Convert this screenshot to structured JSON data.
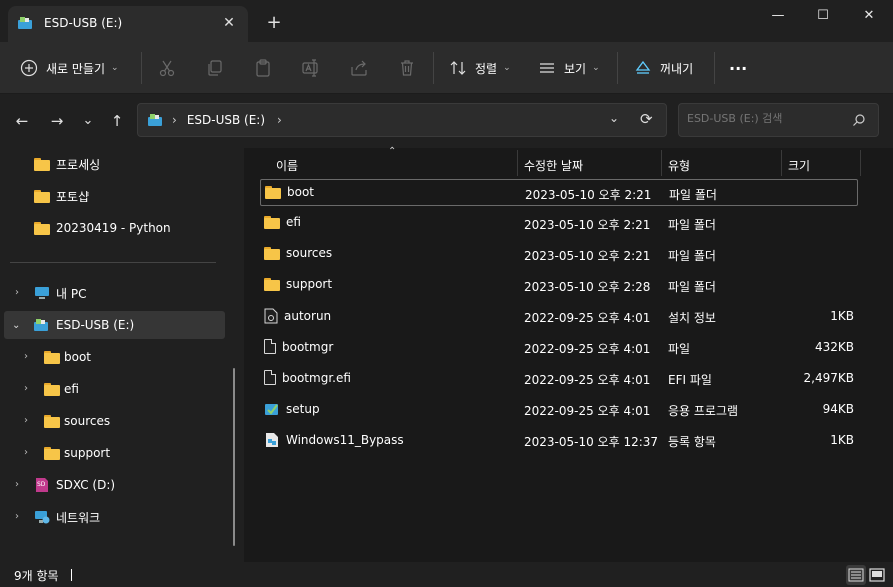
{
  "window": {
    "tab_title": "ESD-USB (E:)",
    "tab_close": "✕",
    "new_tab": "+",
    "minimize": "—",
    "maximize": "☐",
    "close": "✕"
  },
  "toolbar": {
    "new_label": "새로 만들기",
    "sort_label": "정렬",
    "view_label": "보기",
    "eject_label": "꺼내기",
    "more": "···",
    "icons": [
      "cut-icon",
      "copy-icon",
      "paste-icon",
      "rename-icon",
      "share-icon",
      "delete-icon"
    ]
  },
  "nav": {
    "back": "←",
    "forward": "→",
    "recent": "⌄",
    "up": "↑",
    "path": "ESD-USB (E:)",
    "refresh": "⟳",
    "search_placeholder": "ESD-USB (E:) 검색"
  },
  "sidebar": {
    "quick": [
      {
        "label": "프로세싱"
      },
      {
        "label": "포토샵"
      },
      {
        "label": "20230419 - Python"
      }
    ],
    "tree": [
      {
        "label": "내 PC"
      },
      {
        "label": "ESD-USB (E:)"
      },
      {
        "label": "boot"
      },
      {
        "label": "efi"
      },
      {
        "label": "sources"
      },
      {
        "label": "support"
      },
      {
        "label": "SDXC (D:)"
      },
      {
        "label": "네트워크"
      }
    ]
  },
  "columns": {
    "name": "이름",
    "modified": "수정한 날짜",
    "type": "유형",
    "size": "크기"
  },
  "files": [
    {
      "name": "boot",
      "modified": "2023-05-10 오후 2:21",
      "type": "파일 폴더",
      "size": "",
      "icon": "folder-icon"
    },
    {
      "name": "efi",
      "modified": "2023-05-10 오후 2:21",
      "type": "파일 폴더",
      "size": "",
      "icon": "folder-icon"
    },
    {
      "name": "sources",
      "modified": "2023-05-10 오후 2:21",
      "type": "파일 폴더",
      "size": "",
      "icon": "folder-icon"
    },
    {
      "name": "support",
      "modified": "2023-05-10 오후 2:28",
      "type": "파일 폴더",
      "size": "",
      "icon": "folder-icon"
    },
    {
      "name": "autorun",
      "modified": "2022-09-25 오후 4:01",
      "type": "설치 정보",
      "size": "1KB",
      "icon": "settings-file-icon"
    },
    {
      "name": "bootmgr",
      "modified": "2022-09-25 오후 4:01",
      "type": "파일",
      "size": "432KB",
      "icon": "file-icon"
    },
    {
      "name": "bootmgr.efi",
      "modified": "2022-09-25 오후 4:01",
      "type": "EFI 파일",
      "size": "2,497KB",
      "icon": "file-icon"
    },
    {
      "name": "setup",
      "modified": "2022-09-25 오후 4:01",
      "type": "응용 프로그램",
      "size": "94KB",
      "icon": "setup-app-icon"
    },
    {
      "name": "Windows11_Bypass",
      "modified": "2023-05-10 오후 12:37",
      "type": "등록 항목",
      "size": "1KB",
      "icon": "registry-file-icon"
    }
  ],
  "status": {
    "count": "9개 항목"
  },
  "colors": {
    "folder": "#f7c548",
    "accent": "#60cdff",
    "background": "#191919"
  }
}
